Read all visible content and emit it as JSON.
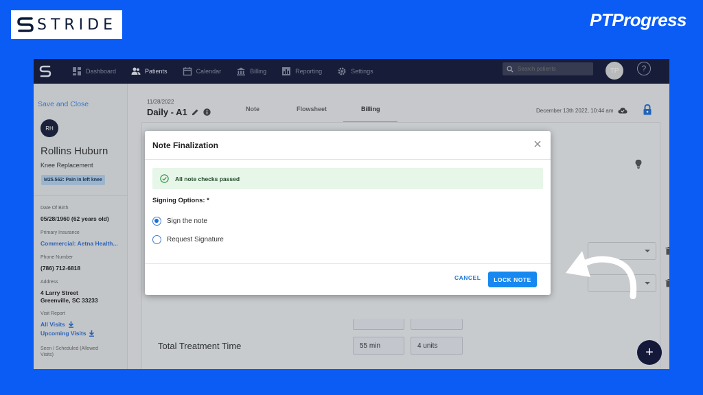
{
  "branding": {
    "left_logo_text": "STRIDE",
    "right_logo_text": "PTProgress"
  },
  "topnav": {
    "items": [
      {
        "label": "Dashboard",
        "icon": "dashboard-icon"
      },
      {
        "label": "Patients",
        "icon": "patients-icon",
        "active": true
      },
      {
        "label": "Calendar",
        "icon": "calendar-icon"
      },
      {
        "label": "Billing",
        "icon": "billing-icon"
      },
      {
        "label": "Reporting",
        "icon": "reporting-icon"
      },
      {
        "label": "Settings",
        "icon": "settings-icon"
      }
    ],
    "search_placeholder": "Search patients",
    "user_initials": "TP",
    "help_label": "?"
  },
  "patient": {
    "save_close": "Save and Close",
    "initials": "RH",
    "name": "Rollins Huburn",
    "condition": "Knee Replacement",
    "icd_code": "M25.562: Pain in left knee",
    "dob_label": "Date Of Birth",
    "dob_value": "05/28/1960 (62 years old)",
    "insurance_label": "Primary Insurance",
    "insurance_value": "Commercial: Aetna Health...",
    "phone_label": "Phone Number",
    "phone_value": "(786) 712-6818",
    "address_label": "Address",
    "address_line1": "4 Larry Street",
    "address_line2": "Greenville, SC 33233",
    "visit_report_label": "Visit Report",
    "all_visits": "All Visits",
    "upcoming_visits": "Upcoming Visits",
    "seen_label_1": "Seen / Scheduled (Allowed",
    "seen_label_2": "Visits)"
  },
  "note": {
    "date": "11/28/2022",
    "title": "Daily - A1",
    "tabs": [
      "Note",
      "Flowsheet",
      "Billing"
    ],
    "active_tab": "Billing",
    "timestamp": "December 13th 2022, 10:44 am"
  },
  "billing": {
    "total_label": "Total Treatment Time",
    "total_minutes": "55 min",
    "total_units": "4 units"
  },
  "modal": {
    "title": "Note Finalization",
    "status_message": "All note checks passed",
    "signing_label": "Signing Options: *",
    "options": [
      {
        "label": "Sign the note",
        "checked": true
      },
      {
        "label": "Request Signature",
        "checked": false
      }
    ],
    "cancel_label": "CANCEL",
    "lock_label": "LOCK NOTE"
  },
  "fab_label": "+",
  "colors": {
    "background": "#0b5cf5",
    "navbar": "#14193a",
    "primary_button": "#1688f0",
    "success_bg": "#e6f6e8"
  }
}
